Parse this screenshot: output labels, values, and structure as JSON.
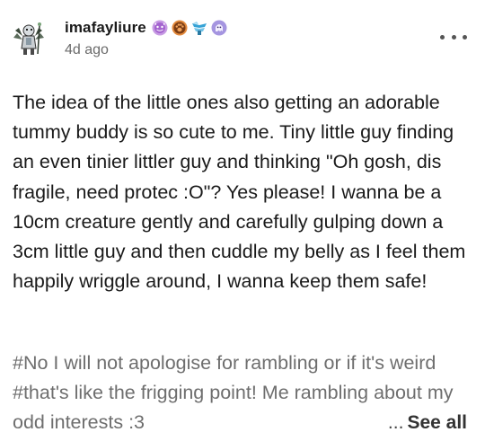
{
  "post": {
    "username": "imafayliure",
    "timestamp": "4d ago",
    "body": "The idea of the little ones also getting an adorable tummy buddy is so cute to me. Tiny little guy finding an even tinier littler guy and thinking \"Oh gosh, dis fragile, need protec :O\"? Yes please! I wanna be a 10cm creature gently and carefully gulping down a 3cm little guy and then cuddle my belly as I feel them happily wriggle around, I wanna keep them safe!",
    "tags": [
      "#No I will not apologise for rambling or if it's weird",
      "#that's like the frigging point! Me rambling about my odd interests :3"
    ],
    "see_all": {
      "ellipsis": "...",
      "label": "See all"
    }
  },
  "badges": [
    {
      "icon": "purple-face-badge-icon",
      "color": "#b57ad6"
    },
    {
      "icon": "orange-paw-badge-icon",
      "color": "#d9752a"
    },
    {
      "icon": "blue-wings-badge-icon",
      "color": "#3fa9d8"
    },
    {
      "icon": "purple-ghost-badge-icon",
      "color": "#8e7bd0"
    }
  ],
  "colors": {
    "text": "#1a1a1a",
    "muted": "#6b6b6b",
    "tag": "#6e6e6e"
  }
}
